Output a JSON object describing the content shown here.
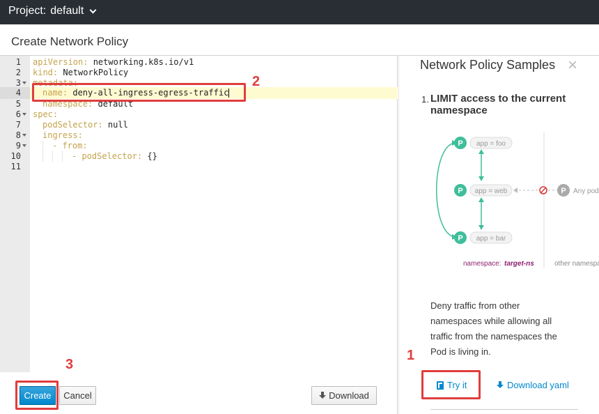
{
  "topbar": {
    "project_label": "Project:",
    "project_value": "default"
  },
  "page": {
    "title": "Create Network Policy"
  },
  "editor": {
    "lines": [
      {
        "n": "1",
        "key": "apiVersion:",
        "val": " networking.k8s.io/v1"
      },
      {
        "n": "2",
        "key": "kind:",
        "val": " NetworkPolicy"
      },
      {
        "n": "3",
        "key": "metadata:",
        "val": ""
      },
      {
        "n": "4",
        "key": "name:",
        "val": " deny-all-ingress-egress-traffic"
      },
      {
        "n": "5",
        "key": "namespace:",
        "val": " default"
      },
      {
        "n": "6",
        "key": "spec:",
        "val": ""
      },
      {
        "n": "7",
        "key": "podSelector:",
        "val": " null"
      },
      {
        "n": "8",
        "key": "ingress:",
        "val": ""
      },
      {
        "n": "9",
        "key": "- from:",
        "val": ""
      },
      {
        "n": "10",
        "key": "- podSelector:",
        "val": " {}"
      },
      {
        "n": "11",
        "key": "",
        "val": ""
      }
    ]
  },
  "actions": {
    "create": "Create",
    "cancel": "Cancel",
    "download": "Download"
  },
  "sidebar": {
    "title": "Network Policy Samples",
    "close": "×",
    "sample": {
      "number": "1.",
      "title": "LIMIT access to the current namespace",
      "diagram": {
        "pods": [
          "app = foo",
          "app = web",
          "app = bar"
        ],
        "pod_letter": "P",
        "other_pod": "Any pod",
        "ns_label": "namespace:",
        "ns_value": "target-ns",
        "other_ns": "other namespace"
      },
      "description": "Deny traffic from other namespaces while allowing all traffic from the namespaces the Pod is living in.",
      "try_it": "Try it",
      "download_yaml": "Download yaml"
    }
  },
  "annotations": [
    "1",
    "2",
    "3"
  ],
  "colors": {
    "primary": "#0088ce",
    "annotation": "#e03d3d",
    "pod": "#3fbe9b",
    "yaml_key": "#c5a34d"
  }
}
